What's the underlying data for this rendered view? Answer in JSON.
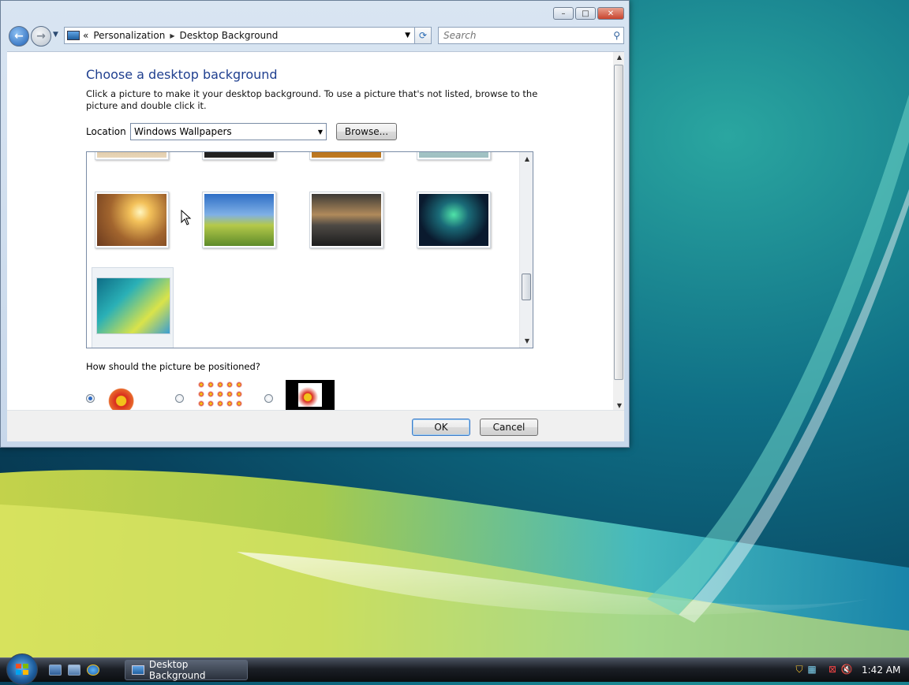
{
  "window": {
    "breadcrumb": [
      "Personalization",
      "Desktop Background"
    ],
    "breadcrumb_prefix": "«",
    "search_placeholder": "Search"
  },
  "content": {
    "title": "Choose a desktop background",
    "description": "Click a picture to make it your desktop background. To use a picture that's not listed, browse to the picture and double click it.",
    "location_label": "Location",
    "location_value": "Windows Wallpapers",
    "browse_label": "Browse...",
    "position_question": "How should the picture be positioned?",
    "position_options": [
      {
        "name": "fit-to-screen",
        "selected": true
      },
      {
        "name": "tile",
        "selected": false
      },
      {
        "name": "center",
        "selected": false
      }
    ]
  },
  "footer": {
    "ok_label": "OK",
    "cancel_label": "Cancel"
  },
  "taskbar": {
    "task_label": "Desktop Background",
    "clock": "1:42 AM"
  },
  "colors": {
    "title": "#1f3f8f",
    "accent": "#2e6bc4"
  },
  "icons": {
    "back": "arrow-left-icon",
    "forward": "arrow-right-icon",
    "refresh": "refresh-icon",
    "search": "search-icon",
    "start": "windows-logo-icon",
    "tray": [
      "shield-icon",
      "network-icon",
      "volume-mute-icon"
    ]
  }
}
